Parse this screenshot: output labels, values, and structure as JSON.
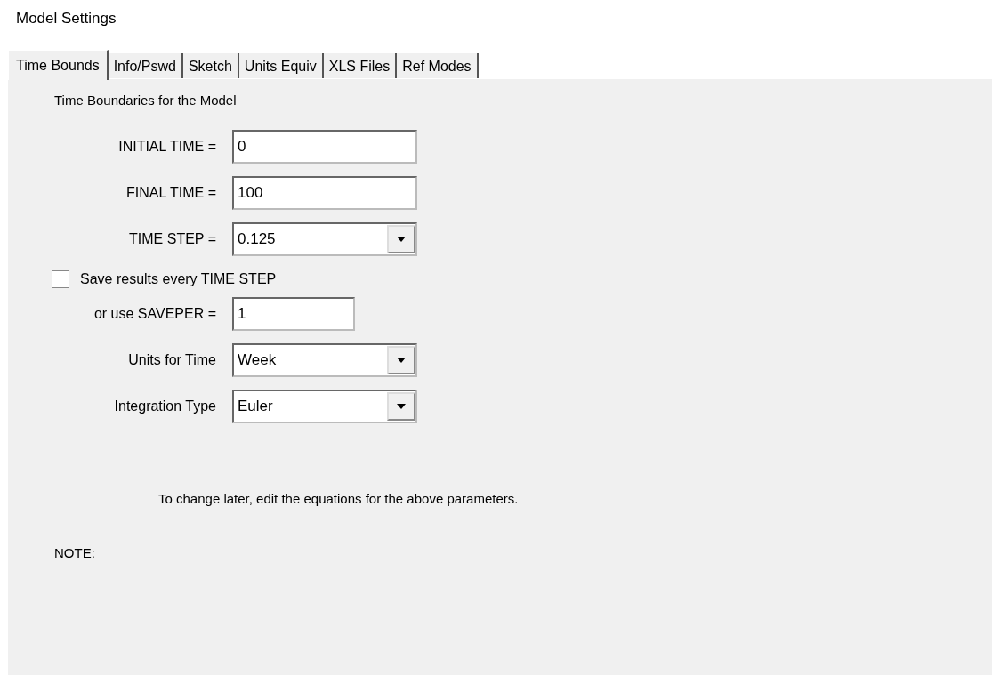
{
  "window": {
    "title": "Model Settings"
  },
  "tabs": [
    {
      "label": "Time Bounds",
      "selected": true
    },
    {
      "label": "Info/Pswd",
      "selected": false
    },
    {
      "label": "Sketch",
      "selected": false
    },
    {
      "label": "Units Equiv",
      "selected": false
    },
    {
      "label": "XLS Files",
      "selected": false
    },
    {
      "label": "Ref Modes",
      "selected": false
    }
  ],
  "panel": {
    "heading": "Time Boundaries for the Model",
    "fields": [
      {
        "label": "INITIAL TIME =",
        "kind": "text",
        "value": "0"
      },
      {
        "label": "FINAL TIME =",
        "kind": "text",
        "value": "100"
      },
      {
        "label": "TIME STEP =",
        "kind": "combo",
        "value": "0.125"
      },
      {
        "label": "Save results every TIME STEP",
        "kind": "checkbox",
        "checked": false
      },
      {
        "label": "or use SAVEPER =",
        "kind": "short",
        "value": "1"
      },
      {
        "label": "Units for Time",
        "kind": "combo",
        "value": "Week"
      },
      {
        "label": "Integration Type",
        "kind": "combo",
        "value": "Euler"
      }
    ],
    "hint": "To change later, edit the equations for the above parameters.",
    "note": "NOTE:"
  }
}
